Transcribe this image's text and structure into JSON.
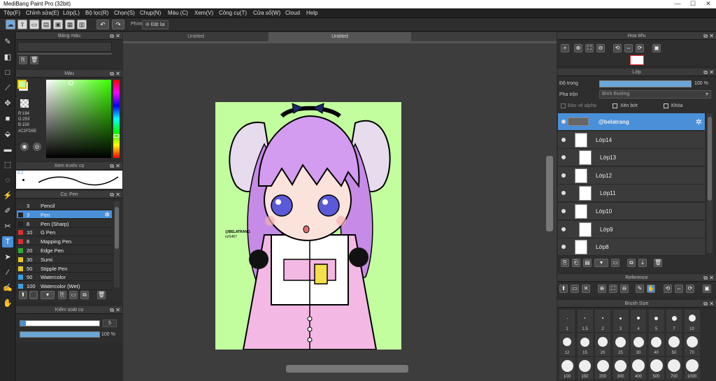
{
  "window": {
    "title": "MediBang Paint Pro (32bit)",
    "minimize": "—",
    "maximize": "☐",
    "close": "✕"
  },
  "menu": [
    "Tệp(F)",
    "Chỉnh sửa(E)",
    "Lớp(L)",
    "Bộ lọc(R)",
    "Chọn(S)",
    "Chụp(N)",
    "Màu (C)",
    "Xem(V)",
    "Công cụ(T)",
    "Cửa sổ(W)",
    "Cloud",
    "Help"
  ],
  "toolbar": {
    "key_label": "Phím",
    "reset_label": "Đặt lại"
  },
  "panels": {
    "color_bar": "Bảng màu",
    "color": "Màu",
    "brush_preview": "Xem trước cọ",
    "brush": "Cọ: Pen",
    "brush_control": "Kiểm soát cọ",
    "navigator": "Hoa tiêu",
    "layer": "Lớp",
    "reference": "Reference",
    "brush_size": "Brush Size"
  },
  "color": {
    "r": "R:194",
    "g": "G:253",
    "b": "B:158",
    "hex": "#C2FD9E",
    "fg": "#C2FD9E",
    "bg": "#FFFFFF"
  },
  "brush_preview_size": "0.2",
  "brushes": [
    {
      "size": "3",
      "name": "Pencil",
      "color": "#333333"
    },
    {
      "size": "3",
      "name": "Pen",
      "color": "#222222"
    },
    {
      "size": "8",
      "name": "Pen (Sharp)",
      "color": "#222222"
    },
    {
      "size": "10",
      "name": "G Pen",
      "color": "#d83030"
    },
    {
      "size": "8",
      "name": "Mapping Pen",
      "color": "#d83030"
    },
    {
      "size": "20",
      "name": "Edge Pen",
      "color": "#2eaa2e"
    },
    {
      "size": "30",
      "name": "Sumi",
      "color": "#e6c62a"
    },
    {
      "size": "50",
      "name": "Stipple Pen",
      "color": "#e6c62a"
    },
    {
      "size": "50",
      "name": "Watercolor",
      "color": "#3aa0e0"
    },
    {
      "size": "100",
      "name": "Watercolor (Wet)",
      "color": "#3aa0e0"
    }
  ],
  "brush_control": {
    "size": "5",
    "opacity": "100 %",
    "size_fill": 1.0,
    "opacity_fill": 1.0
  },
  "tabs": [
    "Untitled",
    "Untitled"
  ],
  "artwork": {
    "watermark": "@BELATRANG",
    "watermark2": "ruf1467",
    "bg_color": "#C2FD9E"
  },
  "layer_panel": {
    "opacity_label": "Độ trong",
    "opacity_value": "100 %",
    "blend_label": "Pha trộn",
    "blend_value": "Bình thường",
    "protect_alpha": "Bảo vệ alpha",
    "clipping": "Xén bớt",
    "lock": "Khóa",
    "layers": [
      "@belatrang",
      "Lớp14",
      "Lớp13",
      "Lớp12",
      "Lớp11",
      "Lớp10",
      "Lớp9",
      "Lớp8"
    ]
  },
  "brush_sizes": [
    "1",
    "1.5",
    "2",
    "3",
    "4",
    "5",
    "7",
    "10",
    "12",
    "15",
    "20",
    "25",
    "30",
    "40",
    "50",
    "70",
    "100",
    "150",
    "200",
    "300",
    "400",
    "500",
    "700",
    "1000"
  ],
  "colors": {
    "accent": "#4a90d9",
    "canvas_bg": "#C2FD9E"
  }
}
